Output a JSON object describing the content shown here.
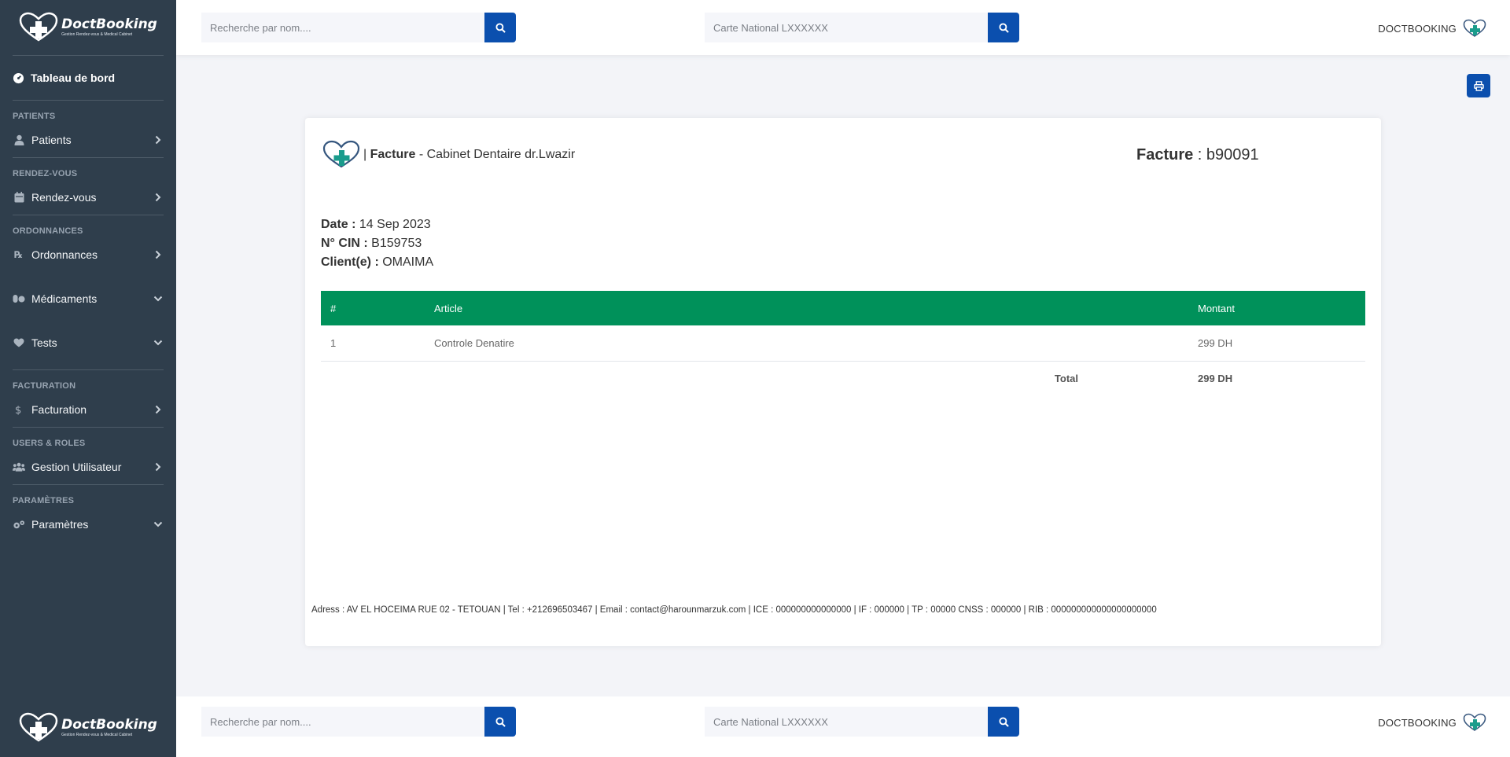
{
  "sidebar": {
    "logo_text": "DoctBooking",
    "logo_sub": "Gestion Rendez-vous & Medical Cabinet",
    "dashboard": "Tableau de bord",
    "sections": [
      {
        "title": "PATIENTS",
        "items": [
          {
            "label": "Patients",
            "icon": "user-icon",
            "chevron": "right"
          }
        ]
      },
      {
        "title": "RENDEZ-VOUS",
        "items": [
          {
            "label": "Rendez-vous",
            "icon": "calendar-icon",
            "chevron": "right"
          }
        ]
      },
      {
        "title": "ORDONNANCES",
        "items": [
          {
            "label": "Ordonnances",
            "icon": "prescription-icon",
            "chevron": "right"
          },
          {
            "label": "Médicaments",
            "icon": "pills-icon",
            "chevron": "down"
          },
          {
            "label": "Tests",
            "icon": "heart-icon",
            "chevron": "down"
          }
        ]
      },
      {
        "title": "FACTURATION",
        "items": [
          {
            "label": "Facturation",
            "icon": "dollar-icon",
            "chevron": "right"
          }
        ]
      },
      {
        "title": "USERS & ROLES",
        "items": [
          {
            "label": "Gestion Utilisateur",
            "icon": "users-icon",
            "chevron": "right"
          }
        ]
      },
      {
        "title": "PARAMÈTRES",
        "items": [
          {
            "label": "Paramètres",
            "icon": "cogs-icon",
            "chevron": "down"
          }
        ]
      }
    ]
  },
  "topbar": {
    "search_name_placeholder": "Recherche par nom....",
    "search_cin_placeholder": "Carte National LXXXXXX",
    "brand": "DOCTBOOKING"
  },
  "invoice": {
    "header_label": "Facture",
    "header_sep": "| ",
    "clinic": " - Cabinet Dentaire dr.Lwazir",
    "number_label": "Facture",
    "number_value": " : b90091",
    "date_label": "Date :",
    "date_value": " 14 Sep 2023",
    "cin_label": "N° CIN :",
    "cin_value": " B159753",
    "client_label": "Client(e) :",
    "client_value": " OMAIMA",
    "table": {
      "headers": [
        "#",
        "Article",
        "Montant"
      ],
      "rows": [
        {
          "num": "1",
          "article": "Controle Denatire",
          "montant": "299 DH"
        }
      ],
      "total_label": "Total",
      "total_value": "299 DH"
    },
    "footer": "Adress : AV EL HOCEIMA RUE 02 - TETOUAN | Tel : +212696503467 | Email : contact@harounmarzuk.com | ICE : 000000000000000 | IF : 000000 | TP : 00000 CNSS : 000000 | RIB : 000000000000000000000"
  },
  "colors": {
    "sidebar_bg": "#2f3e4c",
    "accent_blue": "#0b4fae",
    "table_header_green": "#00915a",
    "logo_teal": "#1a9c8c"
  }
}
